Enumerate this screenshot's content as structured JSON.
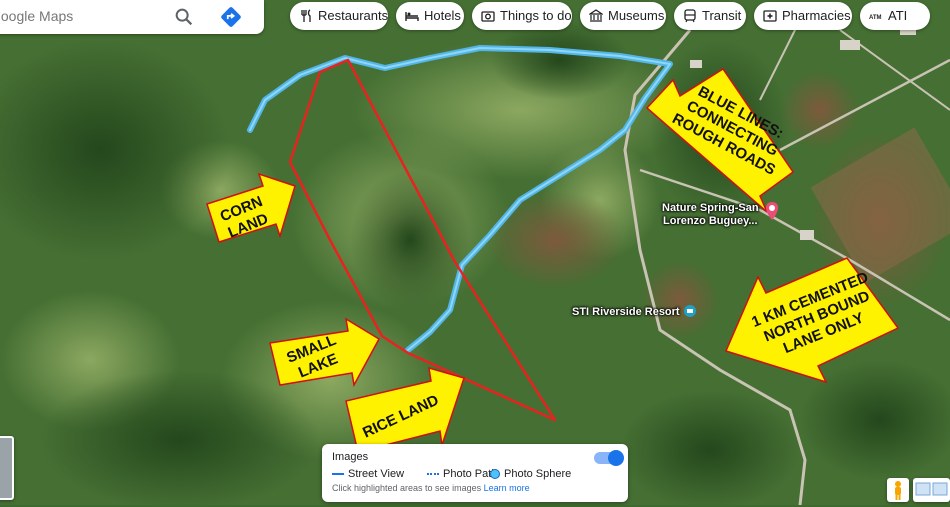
{
  "search": {
    "placeholder": "Google Maps"
  },
  "chips": [
    {
      "label": "Restaurants",
      "icon": "restaurant-icon"
    },
    {
      "label": "Hotels",
      "icon": "hotel-icon"
    },
    {
      "label": "Things to do",
      "icon": "camera-icon"
    },
    {
      "label": "Museums",
      "icon": "museum-icon"
    },
    {
      "label": "Transit",
      "icon": "transit-icon"
    },
    {
      "label": "Pharmacies",
      "icon": "pharmacy-icon"
    },
    {
      "label": "ATI",
      "icon": "atm-icon"
    }
  ],
  "places": {
    "nature_spring_line1": "Nature Spring-San",
    "nature_spring_line2": "Lorenzo Buguey...",
    "sti": "STI Riverside Resort"
  },
  "annotations": {
    "corn_1": "CORN",
    "corn_2": "LAND",
    "lake_1": "SMALL",
    "lake_2": "LAKE",
    "rice": "RICE LAND",
    "blue_1": "BLUE LINES:",
    "blue_2": "CONNECTING",
    "blue_3": "ROUGH ROADS",
    "km_1": "1 KM CEMENTED",
    "km_2": "NORTH BOUND",
    "km_3": "LANE ONLY"
  },
  "images_panel": {
    "title": "Images",
    "street_view": "Street View",
    "photo_path": "Photo Path",
    "photo_sphere": "Photo Sphere",
    "hint": "Click highlighted areas to see images",
    "learn_more": "Learn more",
    "toggle_on": true
  },
  "colors": {
    "property_line": "#e8231f",
    "road_line": "#52b6e8",
    "arrow_fill": "#fff200"
  }
}
